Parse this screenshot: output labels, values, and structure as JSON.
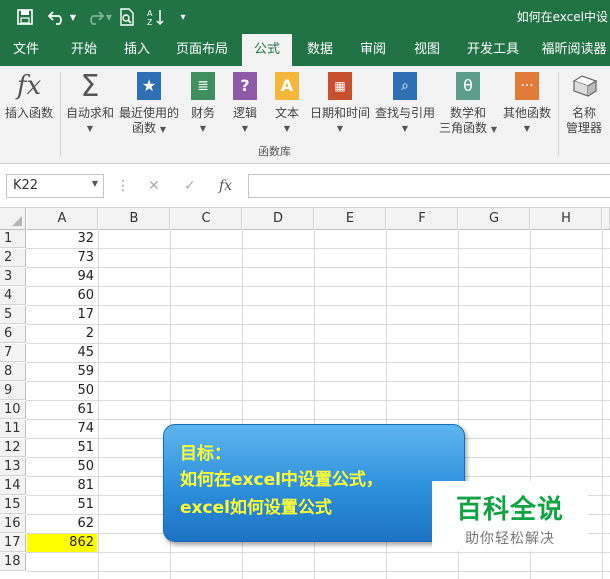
{
  "window": {
    "title": "如何在excel中设"
  },
  "quick_access": {
    "save_icon": "save-icon",
    "undo_icon": "undo-icon",
    "redo_icon": "redo-icon",
    "print_preview_icon": "print-preview-icon",
    "sort_icon": "sort-icon",
    "customize_icon": "customize-toolbar-icon"
  },
  "tabs": [
    {
      "label": "文件"
    },
    {
      "label": "开始"
    },
    {
      "label": "插入"
    },
    {
      "label": "页面布局"
    },
    {
      "label": "公式",
      "active": true
    },
    {
      "label": "数据"
    },
    {
      "label": "审阅"
    },
    {
      "label": "视图"
    },
    {
      "label": "开发工具"
    },
    {
      "label": "福昕阅读器"
    }
  ],
  "ribbon": {
    "insert_function": "插入函数",
    "autosum": "自动求和",
    "recently_used_1": "最近使用的",
    "recently_used_2": "函数",
    "financial": "财务",
    "logical": "逻辑",
    "text": "文本",
    "date_time": "日期和时间",
    "lookup": "查找与引用",
    "math_1": "数学和",
    "math_2": "三角函数",
    "more": "其他函数",
    "name_mgr_1": "名称",
    "name_mgr_2": "管理器",
    "group_label": "函数库"
  },
  "formula_bar": {
    "name_box": "K22",
    "fx": "fx",
    "cancel": "✕",
    "enter": "✓",
    "content": ""
  },
  "grid": {
    "columns": [
      "A",
      "B",
      "C",
      "D",
      "E",
      "F",
      "G",
      "H"
    ],
    "rows": [
      "1",
      "2",
      "3",
      "4",
      "5",
      "6",
      "7",
      "8",
      "9",
      "10",
      "11",
      "12",
      "13",
      "14",
      "15",
      "16",
      "17",
      "18"
    ],
    "column_a_values": [
      "32",
      "73",
      "94",
      "60",
      "17",
      "2",
      "45",
      "59",
      "50",
      "61",
      "74",
      "51",
      "50",
      "81",
      "51",
      "62",
      "862",
      ""
    ],
    "highlight_color": "#ffff00"
  },
  "callout": {
    "line1": "目标：",
    "line2": "如何在excel中设置公式，",
    "line3": "excel如何设置公式"
  },
  "watermark": {
    "title": "百科全说",
    "subtitle": "助你轻松解决"
  },
  "colors": {
    "excel_green": "#217346",
    "ribbon_bg": "#f3f3f3",
    "callout_text": "#ffff33",
    "watermark_green": "#0fa343"
  }
}
